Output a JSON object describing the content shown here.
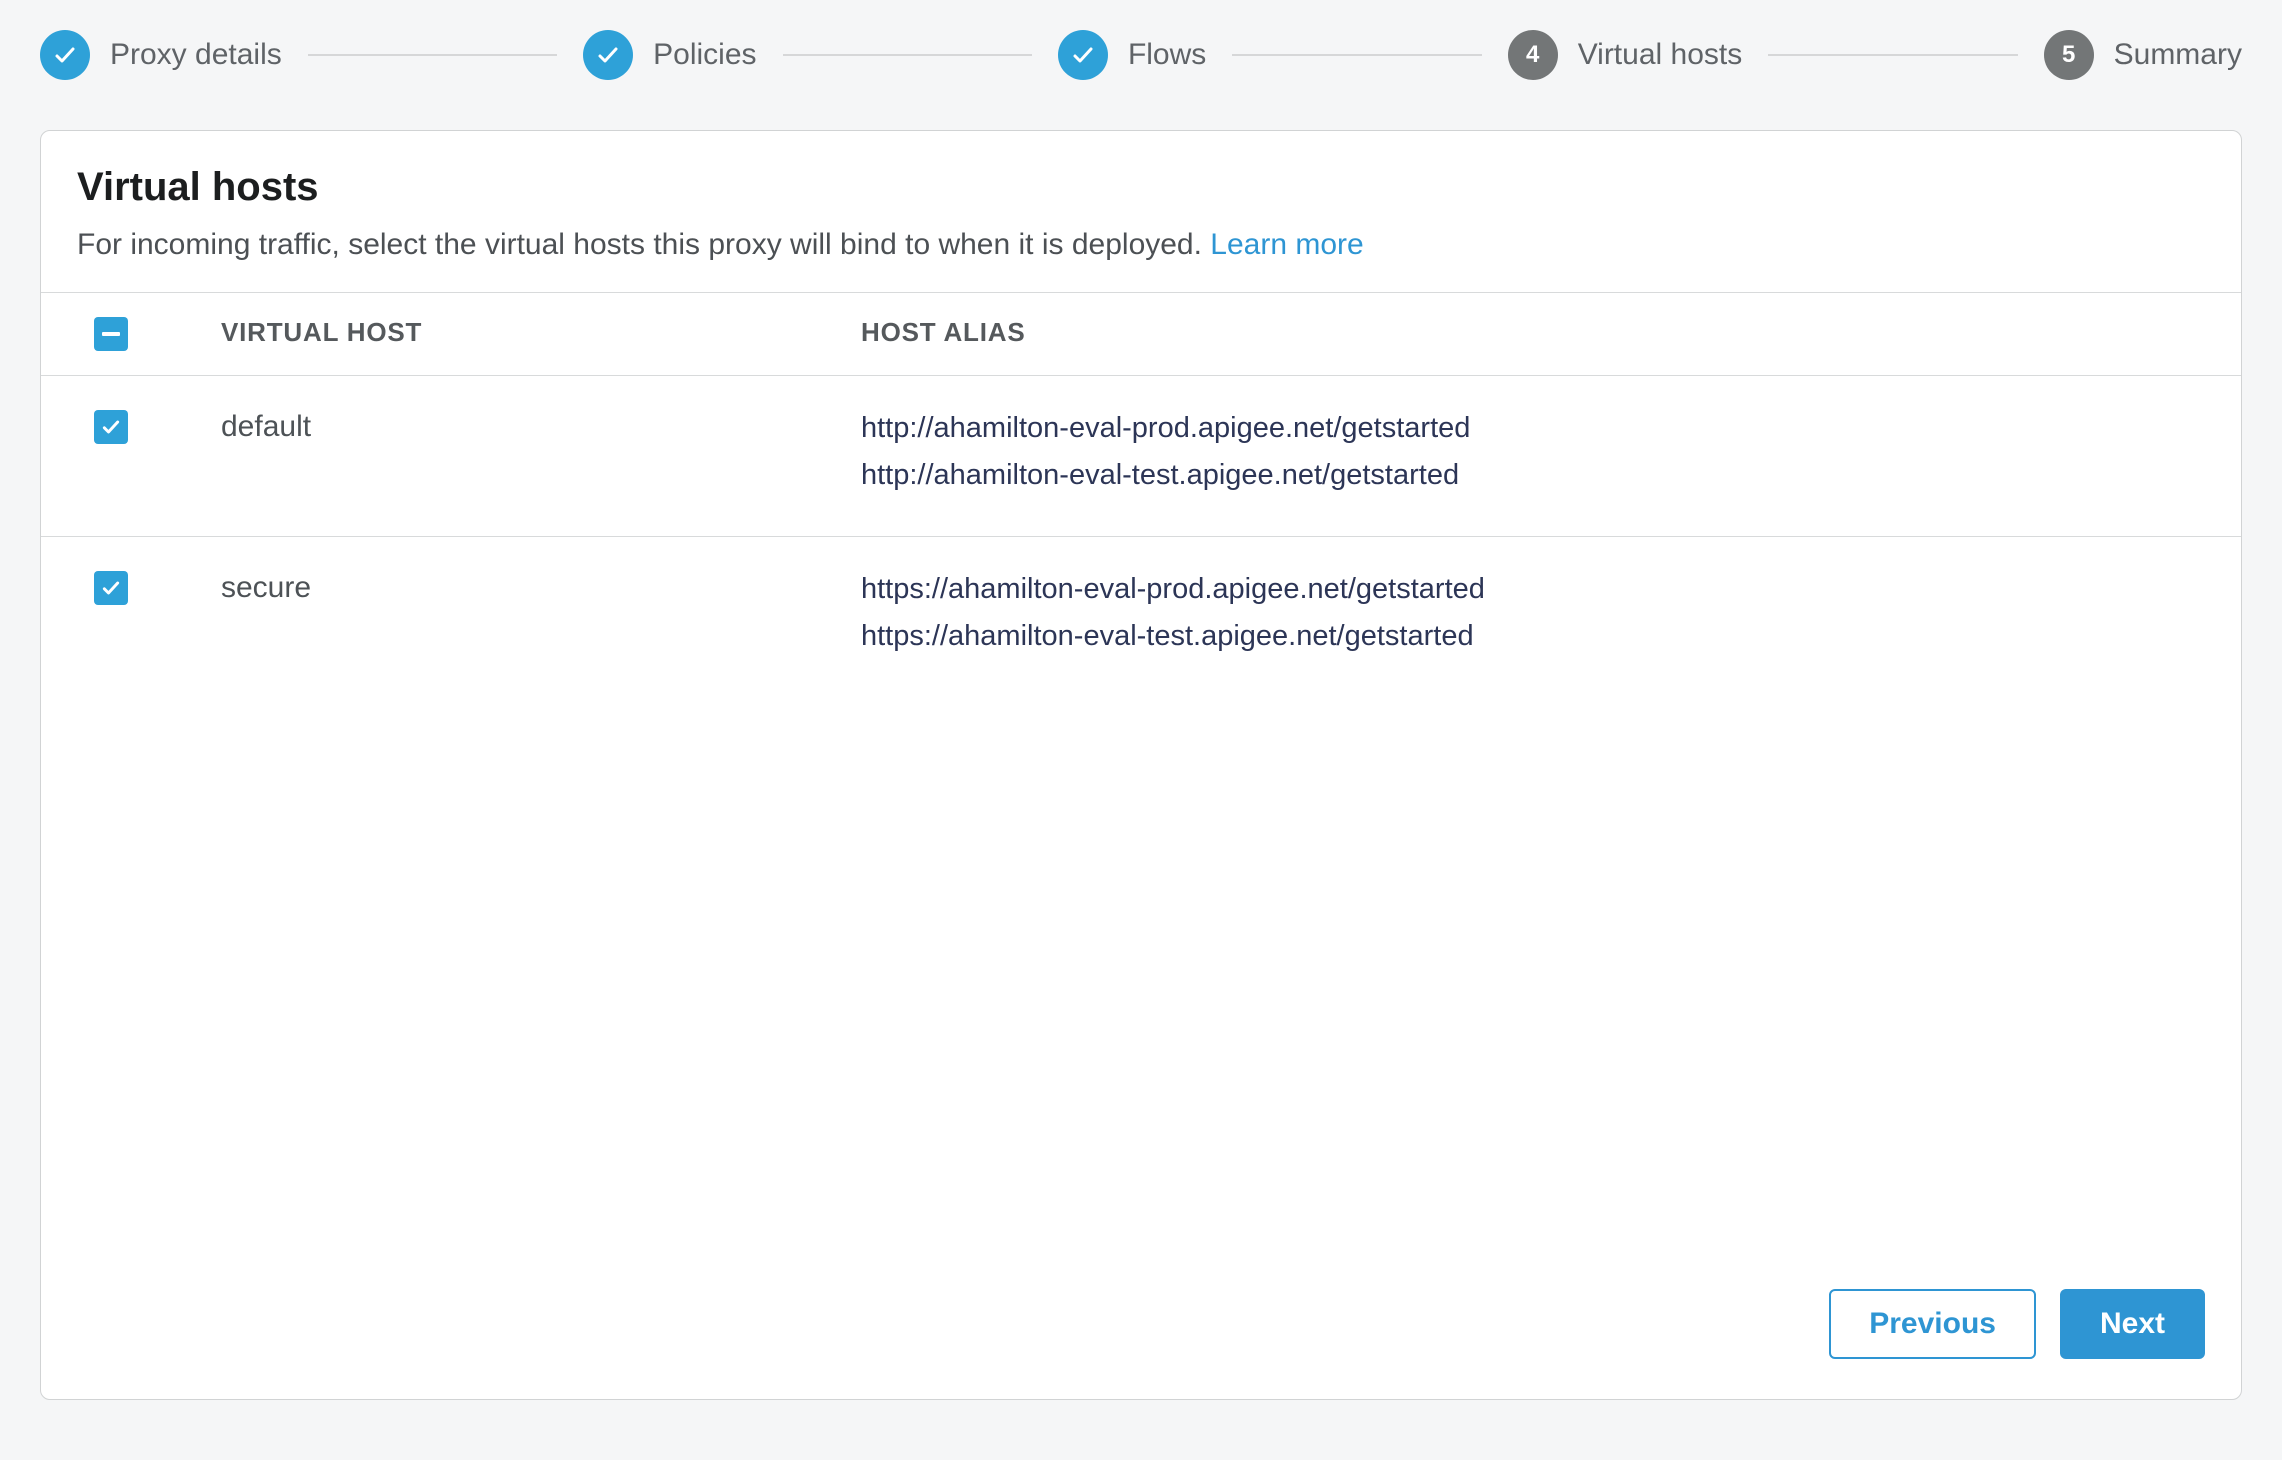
{
  "stepper": {
    "steps": [
      {
        "label": "Proxy details",
        "state": "done"
      },
      {
        "label": "Policies",
        "state": "done"
      },
      {
        "label": "Flows",
        "state": "done"
      },
      {
        "label": "Virtual hosts",
        "state": "current",
        "number": "4"
      },
      {
        "label": "Summary",
        "state": "upcoming",
        "number": "5"
      }
    ]
  },
  "page": {
    "title": "Virtual hosts",
    "description": "For incoming traffic, select the virtual hosts this proxy will bind to when it is deployed. ",
    "learn_more": "Learn more"
  },
  "table": {
    "header_check_state": "indeterminate",
    "columns": {
      "name": "VIRTUAL HOST",
      "alias": "HOST ALIAS"
    },
    "rows": [
      {
        "checked": true,
        "name": "default",
        "aliases": [
          "http://ahamilton-eval-prod.apigee.net/getstarted",
          "http://ahamilton-eval-test.apigee.net/getstarted"
        ]
      },
      {
        "checked": true,
        "name": "secure",
        "aliases": [
          "https://ahamilton-eval-prod.apigee.net/getstarted",
          "https://ahamilton-eval-test.apigee.net/getstarted"
        ]
      }
    ]
  },
  "footer": {
    "previous": "Previous",
    "next": "Next"
  }
}
